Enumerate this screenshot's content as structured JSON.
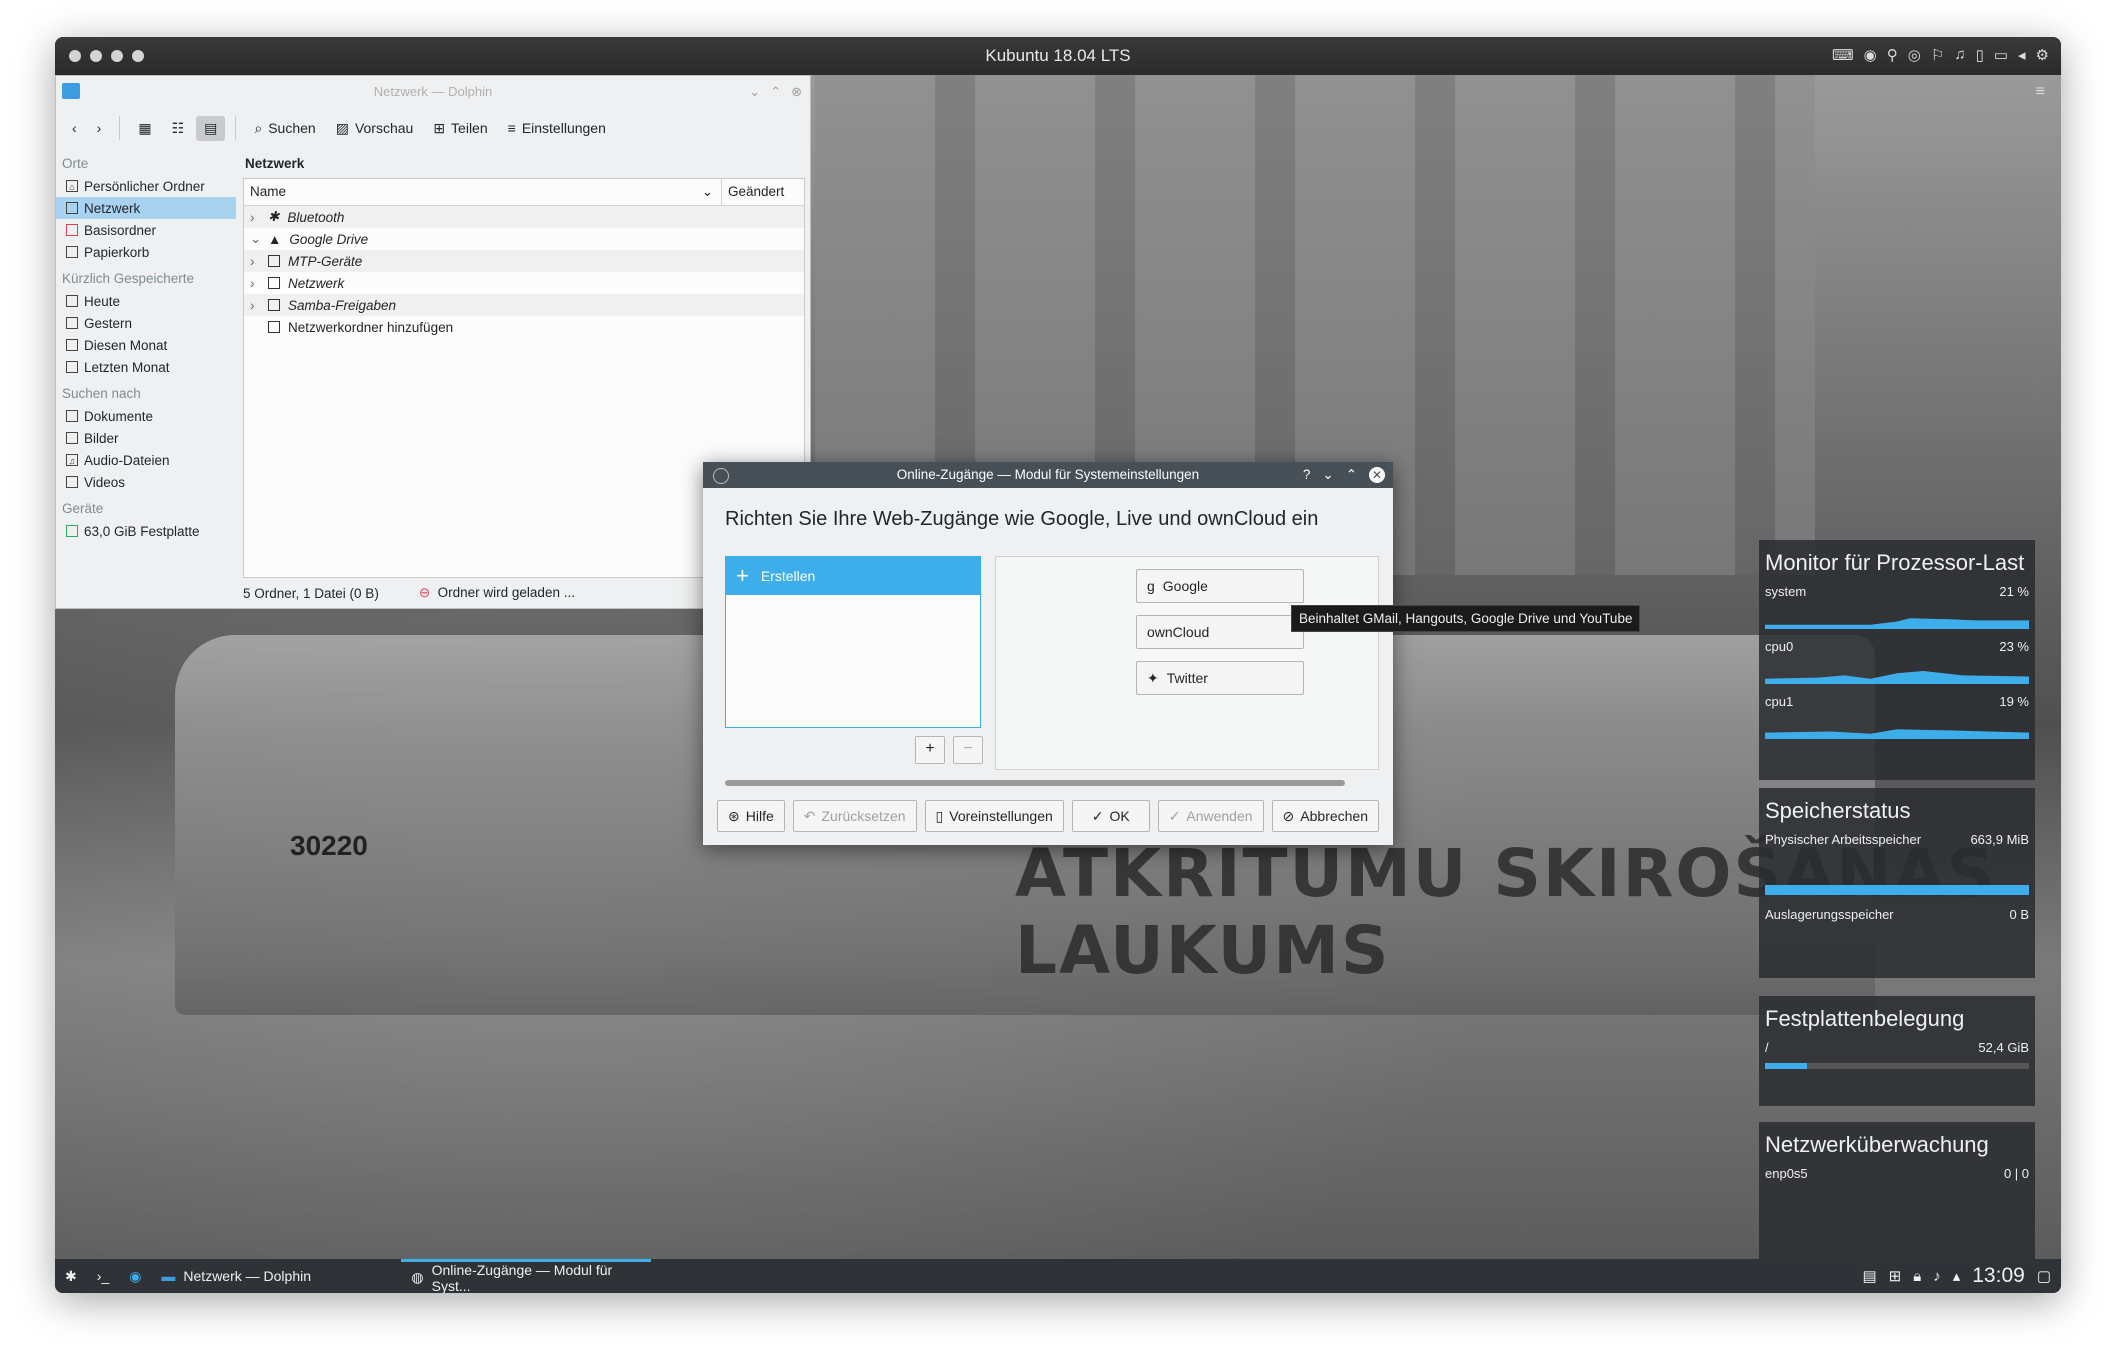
{
  "vm": {
    "title": "Kubuntu 18.04 LTS",
    "icons": [
      "keyboard-icon",
      "record-icon",
      "usb-icon",
      "disc-icon",
      "network-icon",
      "audio-icon",
      "display-icon",
      "camera-icon",
      "arrow-icon",
      "gear-icon"
    ]
  },
  "dolphin": {
    "title": "Netzwerk — Dolphin",
    "toolbar": {
      "search": "Suchen",
      "preview": "Vorschau",
      "share": "Teilen",
      "settings": "Einstellungen"
    },
    "places": {
      "orte": "Orte",
      "orte_items": [
        "Persönlicher Ordner",
        "Netzwerk",
        "Basisordner",
        "Papierkorb"
      ],
      "recent": "Kürzlich Gespeicherte",
      "recent_items": [
        "Heute",
        "Gestern",
        "Diesen Monat",
        "Letzten Monat"
      ],
      "search": "Suchen nach",
      "search_items": [
        "Dokumente",
        "Bilder",
        "Audio-Dateien",
        "Videos"
      ],
      "devices": "Geräte",
      "devices_items": [
        "63,0 GiB Festplatte"
      ]
    },
    "location": "Netzwerk",
    "columns": {
      "name": "Name",
      "modified": "Geändert"
    },
    "rows": [
      "Bluetooth",
      "Google Drive",
      "MTP-Geräte",
      "Netzwerk",
      "Samba-Freigaben",
      "Netzwerkordner hinzufügen"
    ],
    "status": "5 Ordner, 1 Datei (0 B)",
    "loading": "Ordner wird geladen ..."
  },
  "dialog": {
    "title": "Online-Zugänge — Modul für Systemeinstellungen",
    "headline": "Richten Sie Ihre Web-Zugänge wie Google, Live und ownCloud ein",
    "create": "Erstellen",
    "providers": [
      "Google",
      "ownCloud",
      "Twitter"
    ],
    "tooltip": "Beinhaltet GMail, Hangouts, Google Drive und YouTube",
    "buttons": {
      "help": "Hilfe",
      "reset": "Zurücksetzen",
      "defaults": "Voreinstellungen",
      "ok": "OK",
      "apply": "Anwenden",
      "cancel": "Abbrechen"
    }
  },
  "widgets": {
    "cpu": {
      "title": "Monitor für Prozessor-Last",
      "rows": [
        {
          "label": "system",
          "value": "21 %"
        },
        {
          "label": "cpu0",
          "value": "23 %"
        },
        {
          "label": "cpu1",
          "value": "19 %"
        }
      ]
    },
    "mem": {
      "title": "Speicherstatus",
      "phys_label": "Physischer Arbeitsspeicher",
      "phys_value": "663,9 MiB",
      "phys_fill": 1.0,
      "swap_label": "Auslagerungsspeicher",
      "swap_value": "0 B"
    },
    "disk": {
      "title": "Festplattenbelegung",
      "label": "/",
      "value": "52,4 GiB",
      "fill": 0.16
    },
    "net": {
      "title": "Netzwerküberwachung",
      "label": "enp0s5",
      "value": "0 | 0"
    }
  },
  "taskbar": {
    "task1": "Netzwerk — Dolphin",
    "task2": "Online-Zugänge — Modul für Syst...",
    "clock": "13:09"
  },
  "wallpaper_text": {
    "sign": "ATKRITUMU SKIROŠANAS LAUKUMS",
    "tram_no": "30220"
  },
  "colors": {
    "accent": "#3daee9",
    "selection": "#a9d2f1",
    "titlebar": "#475057"
  }
}
